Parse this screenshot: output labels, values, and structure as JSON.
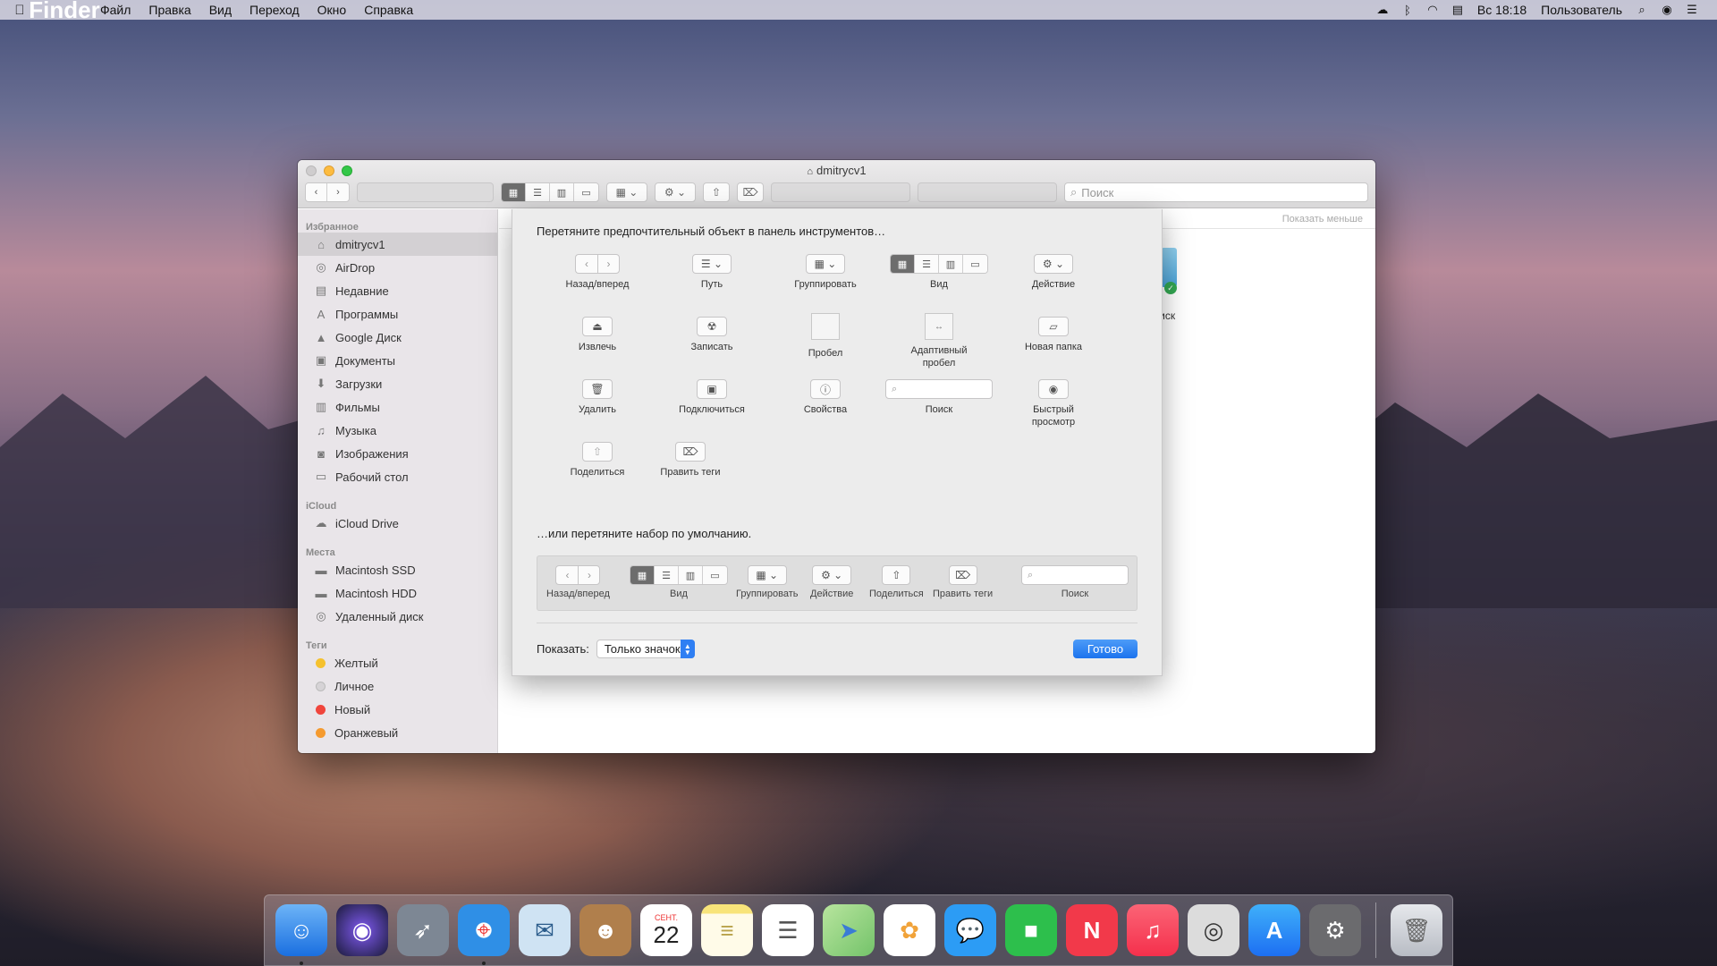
{
  "menubar": {
    "app": "Finder",
    "items": [
      "Файл",
      "Правка",
      "Вид",
      "Переход",
      "Окно",
      "Справка"
    ],
    "clock": "Вс 18:18",
    "user": "Пользователь"
  },
  "window": {
    "title": "dmitrycv1",
    "search_placeholder": "Поиск",
    "show_less": "Показать меньше",
    "disk_label": "Диск"
  },
  "sidebar": {
    "favorites_header": "Избранное",
    "favorites": [
      {
        "label": "dmitrycv1",
        "icon": "home-icon"
      },
      {
        "label": "AirDrop",
        "icon": "airdrop-icon"
      },
      {
        "label": "Недавние",
        "icon": "recents-icon"
      },
      {
        "label": "Программы",
        "icon": "applications-icon"
      },
      {
        "label": "Google Диск",
        "icon": "google-drive-icon"
      },
      {
        "label": "Документы",
        "icon": "documents-icon"
      },
      {
        "label": "Загрузки",
        "icon": "downloads-icon"
      },
      {
        "label": "Фильмы",
        "icon": "movies-icon"
      },
      {
        "label": "Музыка",
        "icon": "music-icon"
      },
      {
        "label": "Изображения",
        "icon": "pictures-icon"
      },
      {
        "label": "Рабочий стол",
        "icon": "desktop-icon"
      }
    ],
    "icloud_header": "iCloud",
    "icloud": [
      {
        "label": "iCloud Drive",
        "icon": "cloud-icon"
      }
    ],
    "places_header": "Места",
    "places": [
      {
        "label": "Macintosh SSD",
        "icon": "disk-icon"
      },
      {
        "label": "Macintosh HDD",
        "icon": "disk-icon"
      },
      {
        "label": "Удаленный диск",
        "icon": "remote-disc-icon"
      }
    ],
    "tags_header": "Теги",
    "tags": [
      {
        "label": "Желтый",
        "color": "#f5c12e"
      },
      {
        "label": "Личное",
        "color": "#d6d3d6"
      },
      {
        "label": "Новый",
        "color": "#f0453c"
      },
      {
        "label": "Оранжевый",
        "color": "#f59a2f"
      }
    ]
  },
  "customize": {
    "prompt": "Перетяните предпочтительный объект в панель инструментов…",
    "items": {
      "back_forward": "Назад/вперед",
      "path": "Путь",
      "group": "Группировать",
      "view": "Вид",
      "action": "Действие",
      "eject": "Извлечь",
      "burn": "Записать",
      "space": "Пробел",
      "flex_space_1": "Адаптивный",
      "flex_space_2": "пробел",
      "new_folder": "Новая папка",
      "delete": "Удалить",
      "connect": "Подключиться",
      "get_info": "Свойства",
      "search": "Поиск",
      "quick_look_1": "Быстрый",
      "quick_look_2": "просмотр",
      "share": "Поделиться",
      "edit_tags": "Править теги"
    },
    "or_text": "…или перетяните набор по умолчанию.",
    "defaults": {
      "back_forward": "Назад/вперед",
      "view": "Вид",
      "group": "Группировать",
      "action": "Действие",
      "share": "Поделиться",
      "edit_tags": "Править теги",
      "search": "Поиск"
    },
    "show_label": "Показать:",
    "show_value": "Только значок",
    "done": "Готово"
  },
  "dock": {
    "apps": [
      {
        "name": "finder-icon",
        "color": "#3d8ff0",
        "glyph": "☺"
      },
      {
        "name": "siri-icon",
        "color": "#2a2a52",
        "glyph": "◉"
      },
      {
        "name": "launchpad-icon",
        "color": "#7d8794",
        "glyph": "🚀"
      },
      {
        "name": "safari-icon",
        "color": "#2f8fe6",
        "glyph": "⌖"
      },
      {
        "name": "mail-icon",
        "color": "#cfe3f3",
        "glyph": "✉"
      },
      {
        "name": "contacts-icon",
        "color": "#b07f4c",
        "glyph": "☻"
      },
      {
        "name": "calendar-icon",
        "color": "#ffffff",
        "glyph": "22",
        "month": "СЕНТ."
      },
      {
        "name": "notes-icon",
        "color": "#f8e47a",
        "glyph": "≡"
      },
      {
        "name": "reminders-icon",
        "color": "#ffffff",
        "glyph": "☰"
      },
      {
        "name": "maps-icon",
        "color": "#74c36a",
        "glyph": "➤"
      },
      {
        "name": "photos-icon",
        "color": "#ffffff",
        "glyph": "✿"
      },
      {
        "name": "messages-icon",
        "color": "#2c9cf5",
        "glyph": "💬"
      },
      {
        "name": "facetime-icon",
        "color": "#2dbf4c",
        "glyph": "■"
      },
      {
        "name": "news-icon",
        "color": "#f2394a",
        "glyph": "N"
      },
      {
        "name": "music-icon",
        "color": "#f5475e",
        "glyph": "♫"
      },
      {
        "name": "screenshot-icon",
        "color": "#dcdcdc",
        "glyph": "◎"
      },
      {
        "name": "app-store-icon",
        "color": "#1d8ff2",
        "glyph": "A"
      },
      {
        "name": "system-preferences-icon",
        "color": "#6b6b6e",
        "glyph": "⚙"
      }
    ],
    "trash": {
      "name": "trash-icon",
      "color": "#c9cbd0",
      "glyph": "🗑"
    }
  }
}
